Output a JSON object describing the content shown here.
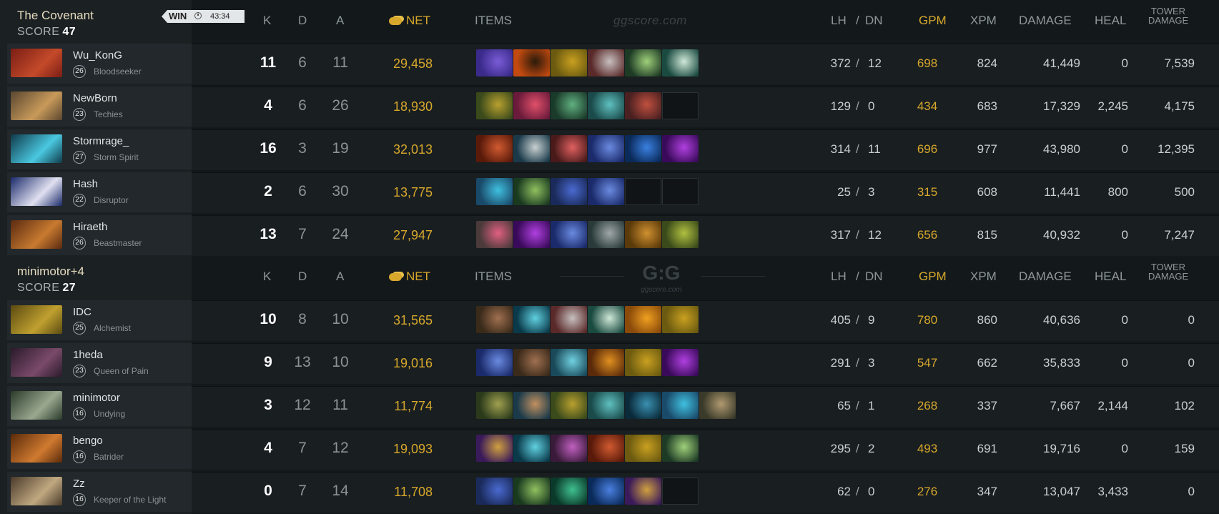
{
  "watermark_top": "ggscore.com",
  "watermark_bottom": {
    "logo": "G:G",
    "site": "ggscore.com"
  },
  "columns": {
    "k": "K",
    "d": "D",
    "a": "A",
    "net": "NET",
    "items": "ITEMS",
    "lh": "LH",
    "slash": "/",
    "dn": "DN",
    "gpm": "GPM",
    "xpm": "XPM",
    "damage": "DAMAGE",
    "heal": "HEAL",
    "tower1": "TOWER",
    "tower2": "DAMAGE"
  },
  "teams": [
    {
      "name": "The Covenant",
      "score_label": "SCORE",
      "score": "47",
      "result": "WIN",
      "duration": "43:34",
      "players": [
        {
          "name": "Wu_KonG",
          "level": "26",
          "hero": "Bloodseeker",
          "avatar_colors": [
            "#7a1d14",
            "#c44a2a"
          ],
          "k": "11",
          "d": "6",
          "a": "11",
          "net": "29,458",
          "lh": "372",
          "dn": "12",
          "gpm": "698",
          "xpm": "824",
          "damage": "41,449",
          "heal": "0",
          "tower": "7,539",
          "items": [
            [
              "#3a2a8a",
              "#7a5cd6"
            ],
            [
              "#c24a10",
              "#2b1a0a"
            ],
            [
              "#6b5a10",
              "#c9a020"
            ],
            [
              "#5a2a2a",
              "#c8c0c0"
            ],
            [
              "#1d3a25",
              "#9fd07a"
            ],
            [
              "#1a4a40",
              "#cfe8d8"
            ]
          ]
        },
        {
          "name": "NewBorn",
          "level": "23",
          "hero": "Techies",
          "avatar_colors": [
            "#5a4630",
            "#c89a5a"
          ],
          "k": "4",
          "d": "6",
          "a": "26",
          "net": "18,930",
          "lh": "129",
          "dn": "0",
          "gpm": "434",
          "xpm": "683",
          "damage": "17,329",
          "heal": "2,245",
          "tower": "4,175",
          "items": [
            [
              "#3a4a1a",
              "#b8a030"
            ],
            [
              "#6a1a3a",
              "#e0506a"
            ],
            [
              "#1a3a2a",
              "#60b080"
            ],
            [
              "#1a4a4a",
              "#60c0c0"
            ],
            [
              "#4a2020",
              "#c05040"
            ],
            null
          ]
        },
        {
          "name": "Stormrage_",
          "level": "27",
          "hero": "Storm Spirit",
          "avatar_colors": [
            "#0f3a4a",
            "#4ac8e0"
          ],
          "k": "16",
          "d": "3",
          "a": "19",
          "net": "32,013",
          "lh": "314",
          "dn": "11",
          "gpm": "696",
          "xpm": "977",
          "damage": "43,980",
          "heal": "0",
          "tower": "12,395",
          "items": [
            [
              "#5a1a0a",
              "#d05a30"
            ],
            [
              "#1a3a4a",
              "#c8d0d0"
            ],
            [
              "#4a1a1a",
              "#e06060"
            ],
            [
              "#1a2a6a",
              "#6a8ae0"
            ],
            [
              "#0a2a5a",
              "#3a80e0"
            ],
            [
              "#3a0a5a",
              "#b040e0"
            ]
          ]
        },
        {
          "name": "Hash",
          "level": "22",
          "hero": "Disruptor",
          "avatar_colors": [
            "#1a2a6a",
            "#e0e0f0"
          ],
          "k": "2",
          "d": "6",
          "a": "30",
          "net": "13,775",
          "lh": "25",
          "dn": "3",
          "gpm": "315",
          "xpm": "608",
          "damage": "11,441",
          "heal": "800",
          "tower": "500",
          "items": [
            [
              "#1a4a6a",
              "#40c0e0"
            ],
            [
              "#1a3a20",
              "#90c060"
            ],
            [
              "#1a2a5a",
              "#4a6ad0"
            ],
            [
              "#1a2a6a",
              "#6a8ae0"
            ],
            null,
            null
          ]
        },
        {
          "name": "Hiraeth",
          "level": "26",
          "hero": "Beastmaster",
          "avatar_colors": [
            "#5a2a10",
            "#c87a30"
          ],
          "k": "13",
          "d": "7",
          "a": "24",
          "net": "27,947",
          "lh": "317",
          "dn": "12",
          "gpm": "656",
          "xpm": "815",
          "damage": "40,932",
          "heal": "0",
          "tower": "7,247",
          "items": [
            [
              "#4a3a3a",
              "#e06080"
            ],
            [
              "#3a0a5a",
              "#b040e0"
            ],
            [
              "#1a2a6a",
              "#6a8ae0"
            ],
            [
              "#2a3a3a",
              "#a0a8a8"
            ],
            [
              "#5a3a0a",
              "#d09030"
            ],
            [
              "#3a4a1a",
              "#b0c040"
            ]
          ]
        }
      ]
    },
    {
      "name": "minimotor+4",
      "score_label": "SCORE",
      "score": "27",
      "players": [
        {
          "name": "IDC",
          "level": "25",
          "hero": "Alchemist",
          "avatar_colors": [
            "#5a4a10",
            "#c0a030"
          ],
          "k": "10",
          "d": "8",
          "a": "10",
          "net": "31,565",
          "lh": "405",
          "dn": "9",
          "gpm": "780",
          "xpm": "860",
          "damage": "40,636",
          "heal": "0",
          "tower": "0",
          "items": [
            [
              "#3a2a1a",
              "#a07050"
            ],
            [
              "#0a3a4a",
              "#60d0e0"
            ],
            [
              "#5a2a2a",
              "#c8c0c0"
            ],
            [
              "#1a4a40",
              "#cfe8d8"
            ],
            [
              "#8a4a0a",
              "#f0a020"
            ],
            [
              "#6b5a10",
              "#c9a020"
            ]
          ]
        },
        {
          "name": "1heda",
          "level": "23",
          "hero": "Queen of Pain",
          "avatar_colors": [
            "#2a1a2a",
            "#7a4a6a"
          ],
          "k": "9",
          "d": "13",
          "a": "10",
          "net": "19,016",
          "lh": "291",
          "dn": "3",
          "gpm": "547",
          "xpm": "662",
          "damage": "35,833",
          "heal": "0",
          "tower": "0",
          "items": [
            [
              "#1a2a6a",
              "#6a8ae0"
            ],
            [
              "#3a2a1a",
              "#a07050"
            ],
            [
              "#1a4a5a",
              "#70d0e0"
            ],
            [
              "#5a2a0a",
              "#e09020"
            ],
            [
              "#6b5a10",
              "#c9a020"
            ],
            [
              "#3a0a5a",
              "#b040e0"
            ]
          ]
        },
        {
          "name": "minimotor",
          "level": "16",
          "hero": "Undying",
          "avatar_colors": [
            "#2a3a2a",
            "#9aa890"
          ],
          "k": "3",
          "d": "12",
          "a": "11",
          "net": "11,774",
          "lh": "65",
          "dn": "1",
          "gpm": "268",
          "xpm": "337",
          "damage": "7,667",
          "heal": "2,144",
          "tower": "102",
          "items": [
            [
              "#2a3a1a",
              "#a0a050"
            ],
            [
              "#1a3a4a",
              "#c09060"
            ],
            [
              "#3a4a1a",
              "#b8a030"
            ],
            [
              "#1a4a4a",
              "#60c0c0"
            ],
            [
              "#0a2a3a",
              "#3a90b0"
            ],
            [
              "#1a4a6a",
              "#40c0e0"
            ],
            [
              "#3a3a2a",
              "#b09a70"
            ]
          ]
        },
        {
          "name": "bengo",
          "level": "16",
          "hero": "Batrider",
          "avatar_colors": [
            "#5a2a0a",
            "#d07a30"
          ],
          "k": "4",
          "d": "7",
          "a": "12",
          "net": "19,093",
          "lh": "295",
          "dn": "2",
          "gpm": "493",
          "xpm": "691",
          "damage": "19,716",
          "heal": "0",
          "tower": "159",
          "items": [
            [
              "#3a1a5a",
              "#d0a040"
            ],
            [
              "#0a3a4a",
              "#60d0e0"
            ],
            [
              "#3a1a3a",
              "#c060c0"
            ],
            [
              "#5a1a0a",
              "#d05a30"
            ],
            [
              "#6b5a10",
              "#c9a020"
            ],
            [
              "#1d3a25",
              "#9fd07a"
            ]
          ]
        },
        {
          "name": "Zz",
          "level": "16",
          "hero": "Keeper of the Light",
          "avatar_colors": [
            "#4a3a2a",
            "#c0a880"
          ],
          "k": "0",
          "d": "7",
          "a": "14",
          "net": "11,708",
          "lh": "62",
          "dn": "0",
          "gpm": "276",
          "xpm": "347",
          "damage": "13,047",
          "heal": "3,433",
          "tower": "0",
          "items": [
            [
              "#1a2a5a",
              "#4a6ad0"
            ],
            [
              "#1a3a20",
              "#90c060"
            ],
            [
              "#0a3a2a",
              "#40c090"
            ],
            [
              "#0a2a5a",
              "#4a80e0"
            ],
            [
              "#3a1a5a",
              "#d0a040"
            ],
            null
          ]
        }
      ]
    }
  ]
}
